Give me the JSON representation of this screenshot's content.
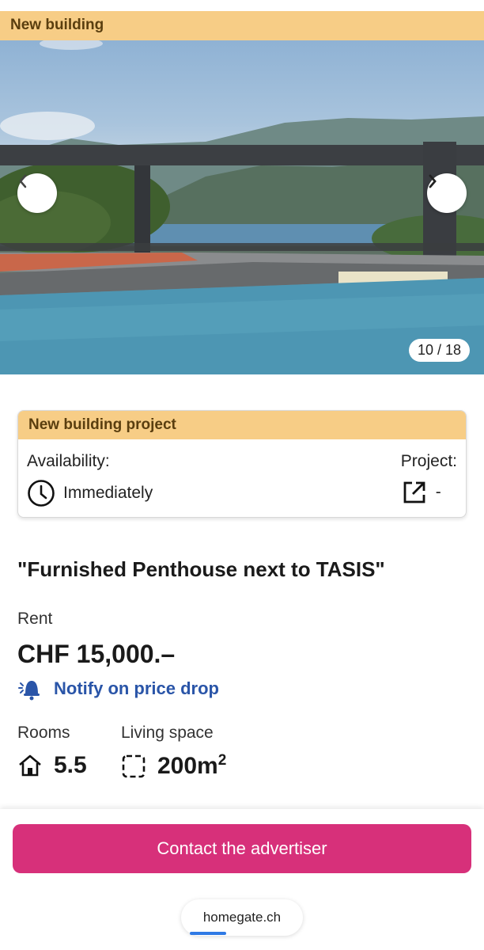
{
  "banner": {
    "label": "New building"
  },
  "gallery": {
    "counter": "10 / 18",
    "prev_icon": "chevron-left-icon",
    "next_icon": "chevron-right-icon"
  },
  "project_card": {
    "header": "New building project",
    "availability_label": "Availability:",
    "availability_value": "Immediately",
    "project_label": "Project:",
    "project_value": "-"
  },
  "listing": {
    "title": "\"Furnished Penthouse next to TASIS\"",
    "rent_label": "Rent",
    "rent_value": "CHF 15,000.–",
    "notify_label": "Notify on price drop",
    "rooms_label": "Rooms",
    "rooms_value": "5.5",
    "space_label": "Living space",
    "space_value": "200m",
    "space_unit_sup": "2"
  },
  "footer": {
    "cta_label": "Contact the advertiser",
    "url": "homegate.ch"
  },
  "colors": {
    "banner": "#f7cd86",
    "cta": "#d7307a",
    "link": "#2a55a8"
  }
}
